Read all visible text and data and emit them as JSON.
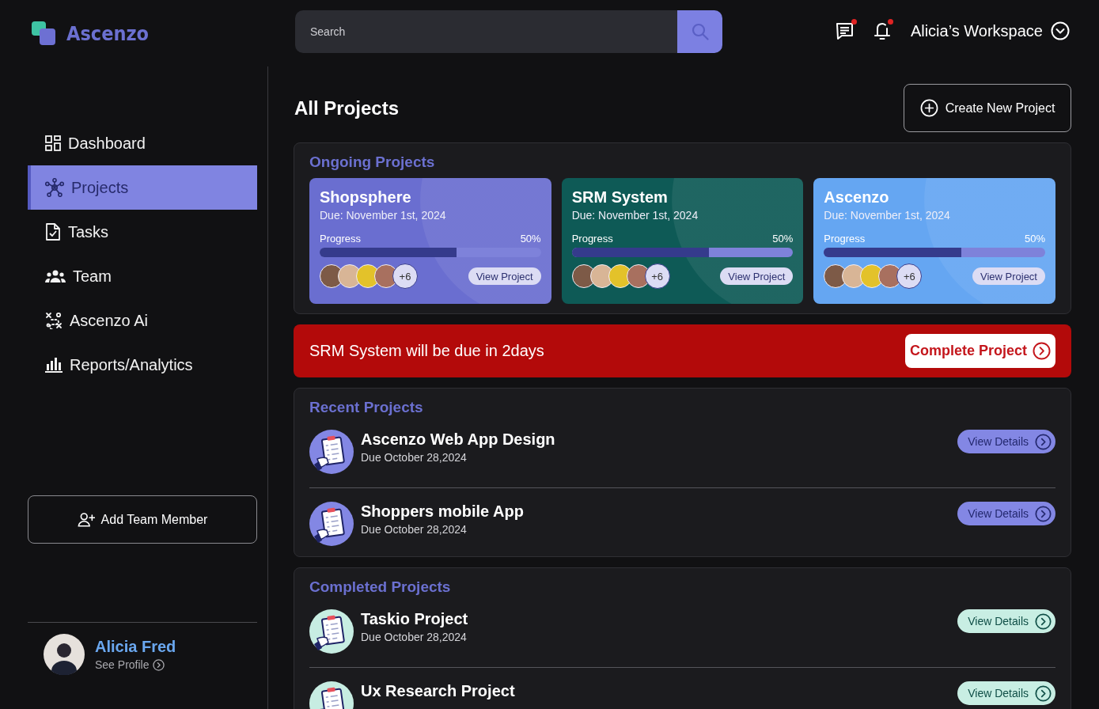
{
  "header": {
    "logo": "Ascenzo",
    "search": {
      "placeholder": "Search"
    },
    "messages": {
      "unread": true
    },
    "notifications": {
      "unread": true
    },
    "workspace": "Alicia’s Workspace"
  },
  "sidebar": {
    "items": [
      {
        "label": "Dashboard",
        "selected": false
      },
      {
        "label": "Projects",
        "selected": true
      },
      {
        "label": "Tasks",
        "selected": false
      },
      {
        "label": "Team",
        "selected": false
      },
      {
        "label": "Ascenzo Ai",
        "selected": false
      },
      {
        "label": "Reports/Analytics",
        "selected": false
      }
    ],
    "add_button": "Add Team Member",
    "profile": {
      "name": "Alicia Fred",
      "link": "See Profile"
    }
  },
  "main": {
    "title": "All Projects",
    "create_button": "Create New Project",
    "ongoing": {
      "title": "Ongoing Projects",
      "cards": [
        {
          "name": "Shopsphere",
          "due": "Due: November 1st, 2024",
          "progress_label": "Progress",
          "percent": "50%",
          "level": 0.62,
          "extra_members": "+6",
          "button": "View Project",
          "color": "#6a6ed0"
        },
        {
          "name": "SRM System",
          "due": "Due: November 1st, 2024",
          "progress_label": "Progress",
          "percent": "50%",
          "level": 0.62,
          "extra_members": "+6",
          "button": "View Project",
          "color": "#0e5a56"
        },
        {
          "name": "Ascenzo",
          "due": "Due: November 1st, 2024",
          "progress_label": "Progress",
          "percent": "50%",
          "level": 0.62,
          "extra_members": "+6",
          "button": "View Project",
          "color": "#65a6f2"
        }
      ]
    },
    "alert": {
      "message": "SRM System will be due in 2days",
      "button": "Complete Project"
    },
    "project_lists": [
      {
        "kind": "recent",
        "title": "Recent Projects",
        "items": [
          {
            "name": "Ascenzo Web App Design",
            "due": "Due October 28,2024",
            "button": "View Details"
          },
          {
            "name": "Shoppers mobile App",
            "due": "Due October 28,2024",
            "button": "View Details"
          }
        ]
      },
      {
        "kind": "completed",
        "title": "Completed Projects",
        "items": [
          {
            "name": "Taskio Project",
            "due": "Due October 28,2024",
            "button": "View Details"
          },
          {
            "name": "Ux Research Project",
            "button": "View Details"
          }
        ]
      }
    ]
  }
}
